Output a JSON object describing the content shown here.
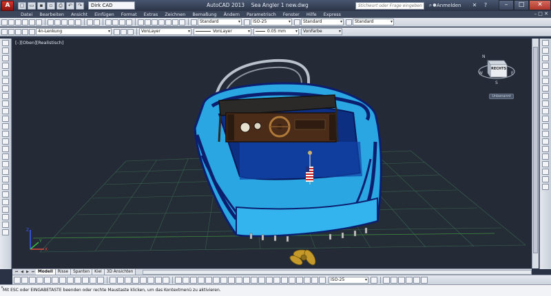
{
  "title_bar": {
    "app_name": "AutoCAD 2013",
    "file_name": "Sea Angler 1 new.dwg",
    "workspace": "Dirk CAD",
    "search_placeholder": "Stichwort oder Frage eingeben",
    "login_label": "Anmelden"
  },
  "menu": {
    "items": [
      "Datei",
      "Bearbeiten",
      "Ansicht",
      "Einfügen",
      "Format",
      "Extras",
      "Zeichnen",
      "Bemaßung",
      "Ändern",
      "Parametrisch",
      "Fenster",
      "Hilfe",
      "Express"
    ]
  },
  "toolbar1": {
    "text_style": "Standard",
    "dim_style": "ISO-25",
    "table_style": "Standard",
    "mleader_style": "Standard"
  },
  "toolbar2": {
    "layer": "4n-Lenkung",
    "color": "VonLayer",
    "linetype": "VonLayer",
    "lineweight": "0.05 mm",
    "plotstyle": "VonFarbe"
  },
  "viewport": {
    "view_label": "[–][Oben][Realistisch]",
    "viewcube_face": "RECHTS",
    "wcs_label": "Unbenannt"
  },
  "layout_tabs": [
    "Modell",
    "Risse",
    "Spanten",
    "Kiel",
    "3D Ansichten"
  ],
  "bottom_toolbar": {
    "dim_style": "ISO-25"
  },
  "command_line": {
    "text": "Mit ESC oder EINGABETASTE beenden oder rechte Maustaste klicken, um das Kontextmenü zu aktivieren."
  },
  "colors": {
    "hull_blue": "#2aa6e3",
    "hull_dark": "#0b1f6e",
    "canopy": "#2b2a28",
    "dashboard_wood": "#4b2c18",
    "grid": "#3e6d54",
    "background": "#242b37"
  }
}
